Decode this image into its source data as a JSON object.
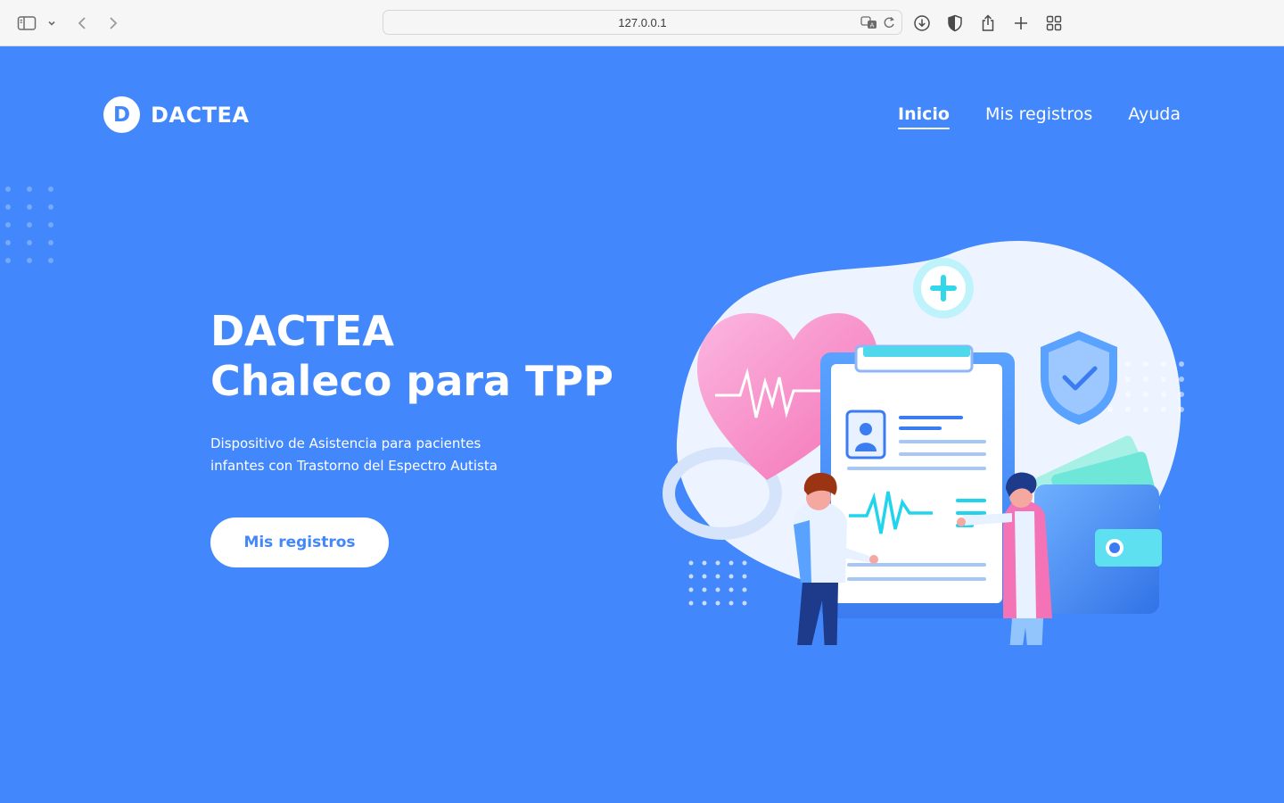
{
  "browser": {
    "url": "127.0.0.1"
  },
  "header": {
    "logo_letter": "D",
    "brand": "DACTEA",
    "nav": [
      {
        "label": "Inicio",
        "active": true
      },
      {
        "label": "Mis registros",
        "active": false
      },
      {
        "label": "Ayuda",
        "active": false
      }
    ]
  },
  "hero": {
    "title_line1": "DACTEA",
    "title_line2": "Chaleco para TPP",
    "subtitle_line1": "Dispositivo de Asistencia para pacientes",
    "subtitle_line2": "infantes con Trastorno del Espectro Autista",
    "cta_label": "Mis registros"
  },
  "colors": {
    "background": "#4287fb",
    "text": "#ffffff",
    "accent_pink": "#f472b6",
    "accent_cyan": "#22d3ee"
  }
}
